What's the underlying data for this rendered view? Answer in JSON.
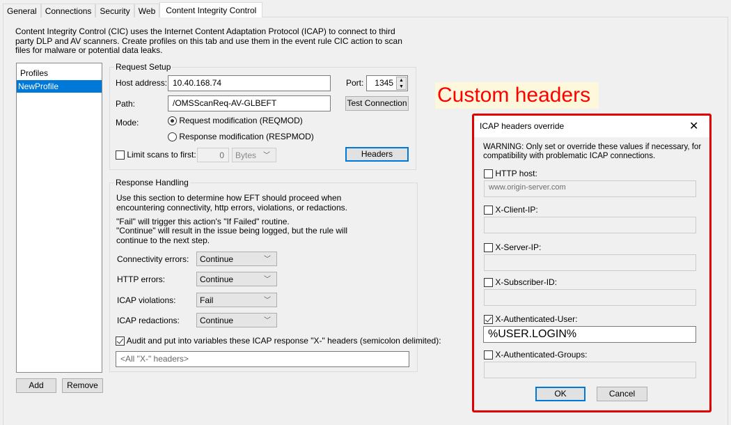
{
  "tabs": [
    "General",
    "Connections",
    "Security",
    "Web",
    "Content Integrity Control"
  ],
  "description": "Content Integrity Control (CIC) uses the Internet Content Adaptation Protocol (ICAP) to connect to third party DLP and AV scanners. Create profiles on this tab and use them in the event rule CIC action to scan files for malware or potential data leaks.",
  "profiles": {
    "header": "Profiles",
    "items": [
      "NewProfile"
    ],
    "add": "Add",
    "remove": "Remove"
  },
  "request": {
    "title": "Request Setup",
    "host_label": "Host address:",
    "host": "10.40.168.74",
    "port_label": "Port:",
    "port": "1345",
    "path_label": "Path:",
    "path": "/OMSScanReq-AV-GLBEFT",
    "test": "Test Connection",
    "mode_label": "Mode:",
    "mode_req": "Request modification (REQMOD)",
    "mode_resp": "Response modification (RESPMOD)",
    "limit_label": "Limit scans to first:",
    "limit_value": "0",
    "limit_unit": "Bytes",
    "headers": "Headers"
  },
  "response": {
    "title": "Response Handling",
    "text1": "Use this section to determine how EFT should proceed when encountering connectivity, http errors, violations, or redactions.",
    "text2": "\"Fail\" will trigger this action's \"If Failed\" routine.",
    "text3": "\"Continue\" will result in the issue being logged, but the rule will continue to the next step.",
    "rows": [
      {
        "label": "Connectivity errors:",
        "value": "Continue"
      },
      {
        "label": "HTTP errors:",
        "value": "Continue"
      },
      {
        "label": "ICAP violations:",
        "value": "Fail"
      },
      {
        "label": "ICAP redactions:",
        "value": "Continue"
      }
    ],
    "audit_label": "Audit and put into variables these ICAP response \"X-\" headers (semicolon delimited):",
    "audit_placeholder": "<All \"X-\" headers>"
  },
  "annotation": "Custom headers",
  "dialog": {
    "title": "ICAP headers override",
    "close": "✕",
    "warning": "WARNING: Only set or override these values if necessary, for compatibility with problematic ICAP connections.",
    "fields": [
      {
        "label": "HTTP host:",
        "value": "www.origin-server.com"
      },
      {
        "label": "X-Client-IP:",
        "value": ""
      },
      {
        "label": "X-Server-IP:",
        "value": ""
      },
      {
        "label": "X-Subscriber-ID:",
        "value": ""
      },
      {
        "label": "X-Authenticated-User:",
        "value": "%USER.LOGIN%"
      },
      {
        "label": "X-Authenticated-Groups:",
        "value": ""
      }
    ],
    "ok": "OK",
    "cancel": "Cancel"
  }
}
